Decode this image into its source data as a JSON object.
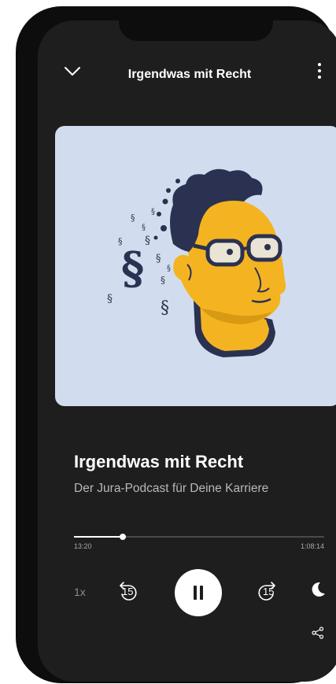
{
  "header": {
    "title": "Irgendwas mit Recht"
  },
  "episode": {
    "title": "Irgendwas mit Recht",
    "subtitle": "Der Jura-Podcast für Deine Karriere"
  },
  "player": {
    "elapsed": "13:20",
    "duration": "1:08:14",
    "progress_fraction": 0.196,
    "speed": "1x",
    "skip_back_seconds": "15",
    "skip_forward_seconds": "15",
    "state": "playing"
  },
  "colors": {
    "background": "#1e1e1e",
    "cover_background": "#d1ddef",
    "accent_yellow": "#f4b421",
    "ink_navy": "#2b3150"
  },
  "icons": [
    "chevron-down-icon",
    "more-vertical-icon",
    "rewind-15-icon",
    "pause-icon",
    "forward-15-icon",
    "moon-icon",
    "share-icon"
  ]
}
